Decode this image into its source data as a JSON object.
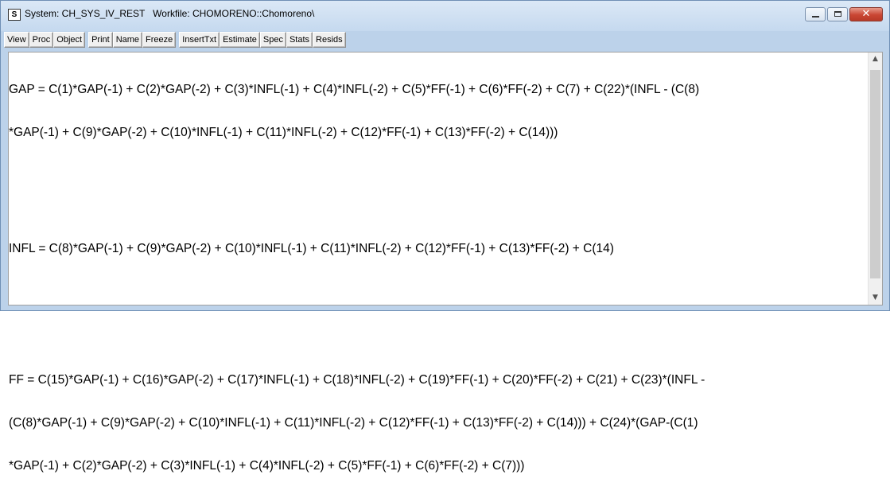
{
  "window": {
    "icon_letter": "S",
    "title": "System: CH_SYS_IV_REST   Workfile: CHOMORENO::Chomoreno\\"
  },
  "window_buttons": {
    "minimize": "minimize-icon",
    "maximize": "maximize-icon",
    "close": "close-icon",
    "close_glyph": "✕"
  },
  "toolbar": {
    "view": "View",
    "proc": "Proc",
    "object": "Object",
    "print": "Print",
    "name": "Name",
    "freeze": "Freeze",
    "inserttxt": "InsertTxt",
    "estimate": "Estimate",
    "spec": "Spec",
    "stats": "Stats",
    "resids": "Resids"
  },
  "equations": {
    "gap": [
      "GAP = C(1)*GAP(-1) + C(2)*GAP(-2) + C(3)*INFL(-1) + C(4)*INFL(-2) + C(5)*FF(-1) + C(6)*FF(-2) + C(7) + C(22)*(INFL - (C(8)",
      "*GAP(-1) + C(9)*GAP(-2) + C(10)*INFL(-1) + C(11)*INFL(-2) + C(12)*FF(-1) + C(13)*FF(-2) + C(14)))"
    ],
    "infl": [
      "INFL = C(8)*GAP(-1) + C(9)*GAP(-2) + C(10)*INFL(-1) + C(11)*INFL(-2) + C(12)*FF(-1) + C(13)*FF(-2) + C(14)"
    ],
    "ff": [
      "FF = C(15)*GAP(-1) + C(16)*GAP(-2) + C(17)*INFL(-1) + C(18)*INFL(-2) + C(19)*FF(-1) + C(20)*FF(-2) + C(21) + C(23)*(INFL -",
      "(C(8)*GAP(-1) + C(9)*GAP(-2) + C(10)*INFL(-1) + C(11)*INFL(-2) + C(12)*FF(-1) + C(13)*FF(-2) + C(14))) + C(24)*(GAP-(C(1)",
      "*GAP(-1) + C(2)*GAP(-2) + C(3)*INFL(-1) + C(4)*INFL(-2) + C(5)*FF(-1) + C(6)*FF(-2) + C(7)))"
    ]
  },
  "scrollbar": {
    "up_glyph": "▲",
    "down_glyph": "▼"
  }
}
